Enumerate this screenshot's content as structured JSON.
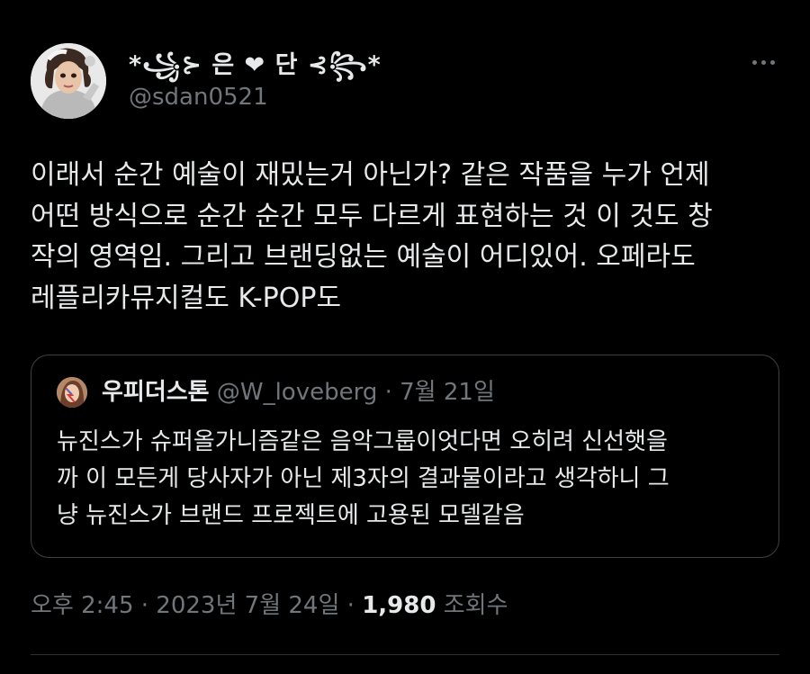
{
  "author": {
    "display_name": "*꧁὎1὎1 은🫀단὎1὎1*",
    "handle": "@sdan0521",
    "avatar_icon": "profile-avatar"
  },
  "tweet": {
    "text_lines": [
      "이래서 순간 예술이 재밌는거 아닌가? 같은 작품을 누가 언제",
      "어떤 방식으로 순간 순간 모두 다르게 표현하는 것 이 것도 창",
      "작의 영역임. 그리고 브랜딩없는 예술이 어디있어. 오페라도",
      "레플리카뮤지컬도 K-POP도"
    ]
  },
  "quoted": {
    "name": "우피더스톤",
    "handle": "@W_loveberg",
    "separator": "·",
    "date": "7월 21일",
    "text_lines": [
      "뉴진스가 슈퍼올가니즘같은 음악그룹이엇다면 오히려 신선햇을",
      "까 이 모든게 당사자가 아닌 제3자의 결과물이라고 생각하니 그",
      "냥 뉴진스가 브랜드 프로젝트에 고용된 모델같음"
    ]
  },
  "footer": {
    "time": "오후 2:45",
    "separator": "·",
    "date": "2023년 7월 24일",
    "views_count": "1,980",
    "views_label": "조회수"
  },
  "colors": {
    "background": "#000000",
    "text_primary": "#e7e9ea",
    "text_secondary": "#71767b",
    "border": "#3e4144"
  }
}
